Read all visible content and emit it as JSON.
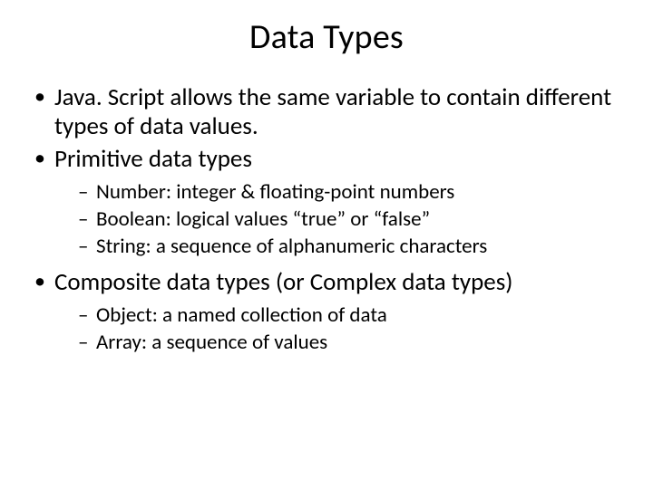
{
  "title": "Data Types",
  "bullets": [
    {
      "text": "Java. Script allows the same variable to contain different types of data values.",
      "sub": []
    },
    {
      "text": "Primitive data types",
      "sub": [
        "Number: integer & floating-point numbers",
        "Boolean: logical values “true” or “false”",
        "String: a sequence of alphanumeric characters"
      ]
    },
    {
      "text": "Composite data types (or Complex data types)",
      "sub": [
        "Object: a named collection of data",
        "Array: a sequence of values"
      ]
    }
  ]
}
